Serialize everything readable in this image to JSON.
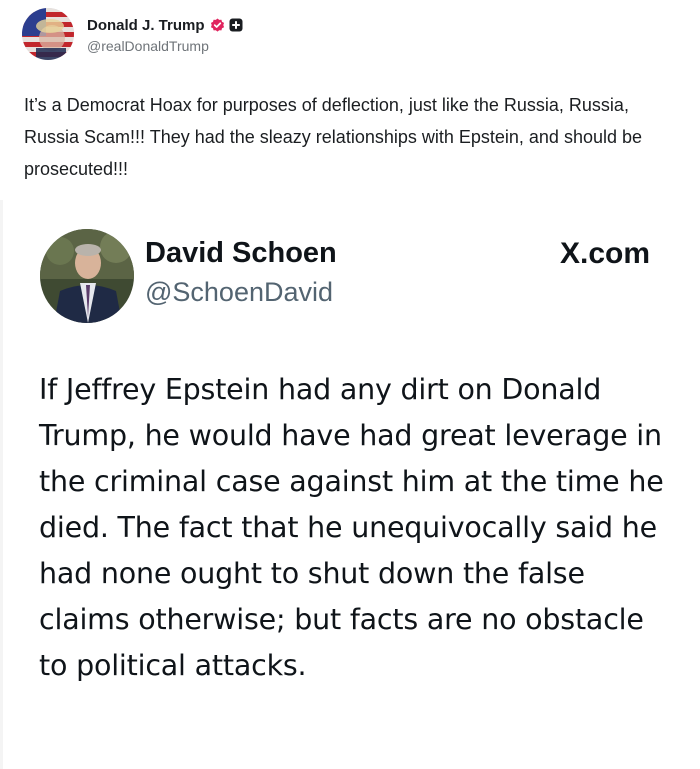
{
  "post": {
    "author": {
      "name": "Donald J. Trump",
      "handle": "@realDonaldTrump",
      "verified_color": "#e0245e"
    },
    "text": "It’s a Democrat Hoax for purposes of deflection, just like the Russia, Russia, Russia Scam!!! They had the sleazy relationships with Epstein, and should be prosecuted!!!"
  },
  "embed": {
    "author": {
      "name": "David Schoen",
      "handle": "@SchoenDavid"
    },
    "source": "X.com",
    "text": "If Jeffrey Epstein had any dirt on Donald Trump, he would have had great leverage in the criminal case against him at the time he died.  The fact that he unequivocally said he had none ought to shut down the false claims otherwise; but facts are no obstacle to political attacks."
  },
  "icons": {
    "verified": "verified-badge-icon",
    "plus": "plus-icon"
  }
}
